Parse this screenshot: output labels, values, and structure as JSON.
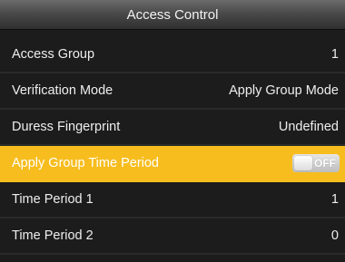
{
  "header": {
    "title": "Access Control"
  },
  "menu": {
    "items": [
      {
        "label": "Access Group",
        "value": "1"
      },
      {
        "label": "Verification Mode",
        "value": "Apply Group Mode"
      },
      {
        "label": "Duress Fingerprint",
        "value": "Undefined"
      },
      {
        "label": "Apply Group Time Period",
        "toggle": "OFF",
        "selected": true
      },
      {
        "label": "Time Period 1",
        "value": "1"
      },
      {
        "label": "Time Period 2",
        "value": "0"
      }
    ]
  },
  "colors": {
    "selected_bg": "#f7bd1e",
    "screen_bg": "#1c1c1c"
  }
}
